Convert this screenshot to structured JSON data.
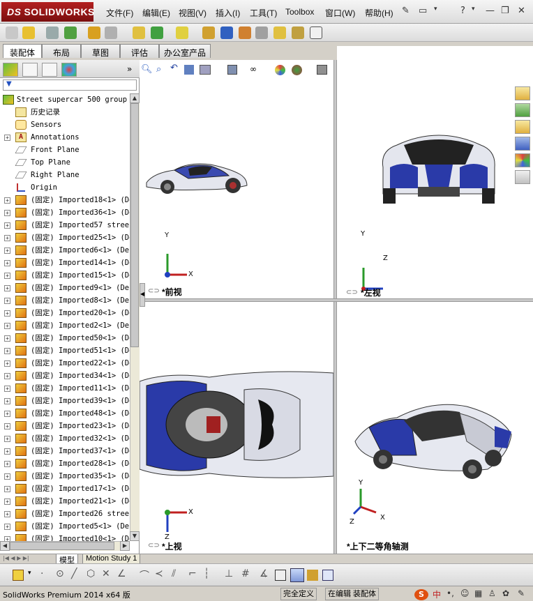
{
  "app": {
    "logo": "SOLIDWORKS",
    "logo_prefix": "DS"
  },
  "menu": [
    "文件(F)",
    "编辑(E)",
    "视图(V)",
    "插入(I)",
    "工具(T)",
    "Toolbox",
    "窗口(W)",
    "帮助(H)"
  ],
  "tabs": [
    "装配体",
    "布局",
    "草图",
    "评估",
    "办公室产品"
  ],
  "tree": {
    "root": "Street supercar 500 group",
    "items": [
      {
        "label": "历史记录",
        "icon": "history-folder-icon",
        "expand": false
      },
      {
        "label": "Sensors",
        "icon": "sensors-icon",
        "expand": false
      },
      {
        "label": "Annotations",
        "icon": "annotations-icon",
        "expand": true
      },
      {
        "label": "Front Plane",
        "icon": "plane-icon",
        "expand": false
      },
      {
        "label": "Top Plane",
        "icon": "plane-icon",
        "expand": false
      },
      {
        "label": "Right Plane",
        "icon": "plane-icon",
        "expand": false
      },
      {
        "label": "Origin",
        "icon": "origin-icon",
        "expand": false
      },
      {
        "label": "(固定) Imported18<1> (De",
        "icon": "part-icon",
        "expand": true
      },
      {
        "label": "(固定) Imported36<1> (De",
        "icon": "part-icon",
        "expand": true
      },
      {
        "label": "(固定) Imported57 stree",
        "icon": "part-icon",
        "expand": true
      },
      {
        "label": "(固定) Imported25<1> (De",
        "icon": "part-icon",
        "expand": true
      },
      {
        "label": "(固定) Imported6<1> (De",
        "icon": "part-icon",
        "expand": true
      },
      {
        "label": "(固定) Imported14<1> (De",
        "icon": "part-icon",
        "expand": true
      },
      {
        "label": "(固定) Imported15<1> (De",
        "icon": "part-icon",
        "expand": true
      },
      {
        "label": "(固定) Imported9<1> (De",
        "icon": "part-icon",
        "expand": true
      },
      {
        "label": "(固定) Imported8<1> (De",
        "icon": "part-icon",
        "expand": true
      },
      {
        "label": "(固定) Imported20<1> (De",
        "icon": "part-icon",
        "expand": true
      },
      {
        "label": "(固定) Imported2<1> (De",
        "icon": "part-icon",
        "expand": true
      },
      {
        "label": "(固定) Imported50<1> (De",
        "icon": "part-icon",
        "expand": true
      },
      {
        "label": "(固定) Imported51<1> (De",
        "icon": "part-icon",
        "expand": true
      },
      {
        "label": "(固定) Imported22<1> (De",
        "icon": "part-icon",
        "expand": true
      },
      {
        "label": "(固定) Imported34<1> (De",
        "icon": "part-icon",
        "expand": true
      },
      {
        "label": "(固定) Imported11<1> (De",
        "icon": "part-icon",
        "expand": true
      },
      {
        "label": "(固定) Imported39<1> (De",
        "icon": "part-icon",
        "expand": true
      },
      {
        "label": "(固定) Imported48<1> (De",
        "icon": "part-icon",
        "expand": true
      },
      {
        "label": "(固定) Imported23<1> (De",
        "icon": "part-icon",
        "expand": true
      },
      {
        "label": "(固定) Imported32<1> (De",
        "icon": "part-icon",
        "expand": true
      },
      {
        "label": "(固定) Imported37<1> (De",
        "icon": "part-icon",
        "expand": true
      },
      {
        "label": "(固定) Imported28<1> (De",
        "icon": "part-icon",
        "expand": true
      },
      {
        "label": "(固定) Imported35<1> (De",
        "icon": "part-icon",
        "expand": true
      },
      {
        "label": "(固定) Imported17<1> (De",
        "icon": "part-icon",
        "expand": true
      },
      {
        "label": "(固定) Imported21<1> (De",
        "icon": "part-icon",
        "expand": true
      },
      {
        "label": "(固定) Imported26 stree",
        "icon": "part-icon",
        "expand": true
      },
      {
        "label": "(固定) Imported5<1> (De",
        "icon": "part-icon",
        "expand": true
      },
      {
        "label": "(固定) Imported10<1> (De",
        "icon": "part-icon",
        "expand": true
      }
    ]
  },
  "views": {
    "front": "*前视",
    "left": "*左视",
    "top": "*上视",
    "iso": "*上下二等角轴测"
  },
  "axes": {
    "x": "X",
    "y": "Y",
    "z": "Z"
  },
  "bottom_tabs": [
    "模型",
    "Motion Study 1"
  ],
  "status": {
    "product": "SolidWorks Premium 2014 x64 版",
    "state": "完全定义",
    "mode": "在编辑 装配体"
  },
  "colors": {
    "car_blue": "#2a3aa8",
    "car_white": "#e6e8f0",
    "accent_red": "#b32020"
  }
}
